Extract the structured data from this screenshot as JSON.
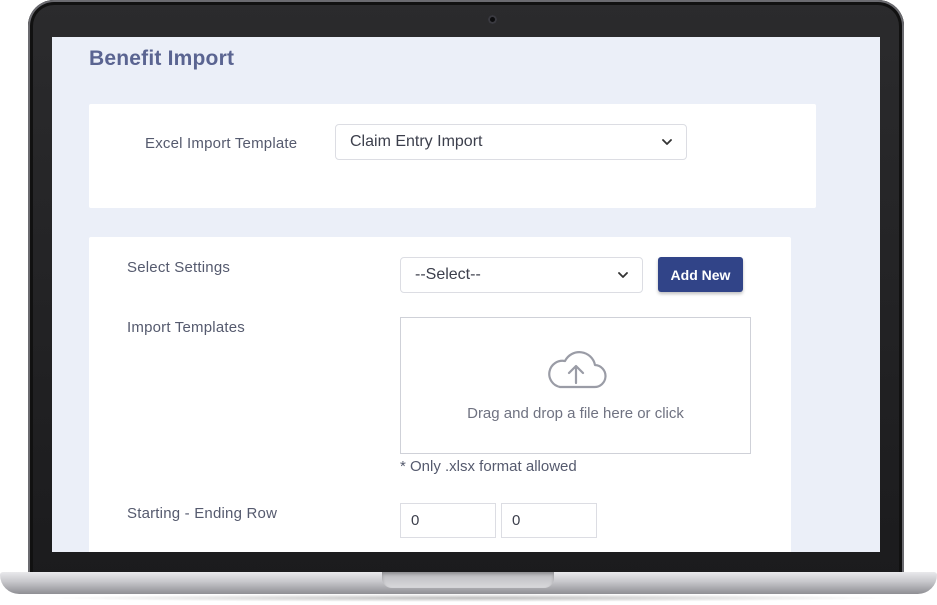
{
  "page": {
    "title": "Benefit Import"
  },
  "template_card": {
    "label": "Excel Import Template",
    "selected": "Claim Entry Import"
  },
  "settings": {
    "label": "Select Settings",
    "selected": "--Select--",
    "add_button": "Add New"
  },
  "import_templates": {
    "label": "Import Templates",
    "dropzone_text": "Drag and drop a file here or click",
    "hint": "* Only .xlsx format allowed"
  },
  "rows": {
    "label": "Starting - Ending Row",
    "start": "0",
    "end": "0"
  },
  "icons": {
    "upload": "cloud-upload-icon",
    "chevron": "chevron-down-icon",
    "camera": "camera-icon"
  },
  "colors": {
    "accent": "#314488",
    "title": "#5a6491",
    "background": "#ebeff8"
  }
}
